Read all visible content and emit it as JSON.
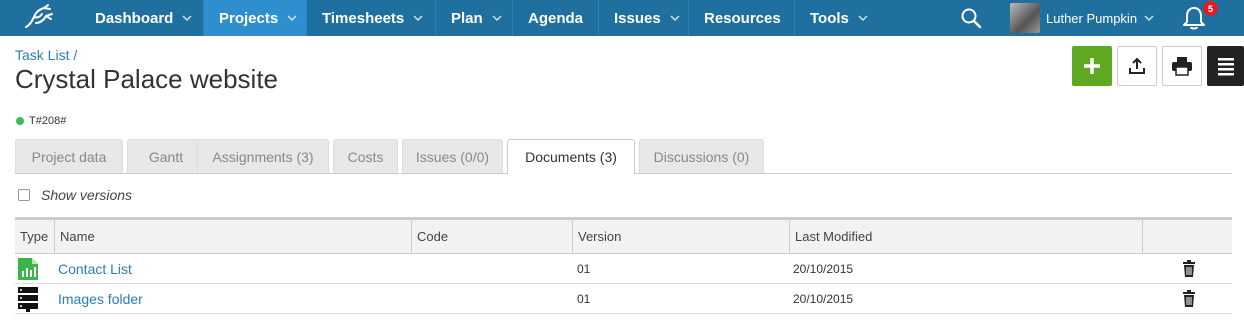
{
  "nav": {
    "items": [
      {
        "label": "Dashboard"
      },
      {
        "label": "Projects"
      },
      {
        "label": "Timesheets"
      },
      {
        "label": "Plan"
      },
      {
        "label": "Agenda"
      },
      {
        "label": "Issues"
      },
      {
        "label": "Resources"
      },
      {
        "label": "Tools"
      }
    ],
    "user_name": "Luther Pumpkin",
    "notification_count": "5"
  },
  "header": {
    "breadcrumb": "Task List /",
    "title": "Crystal Palace website",
    "code": "T#208#"
  },
  "tabs": [
    {
      "label": "Project data"
    },
    {
      "label": "Gantt"
    },
    {
      "label": "Assignments (3)"
    },
    {
      "label": "Costs"
    },
    {
      "label": "Issues (0/0)"
    },
    {
      "label": "Documents (3)"
    },
    {
      "label": "Discussions (0)"
    }
  ],
  "show_versions_label": "Show versions",
  "table": {
    "columns": [
      "Type",
      "Name",
      "Code",
      "Version",
      "Last Modified"
    ],
    "rows": [
      {
        "name": "Contact List",
        "code": "",
        "version": "01",
        "modified": "20/10/2015",
        "icon": "spreadsheet-icon"
      },
      {
        "name": "Images folder",
        "code": "",
        "version": "01",
        "modified": "20/10/2015",
        "icon": "server-icon"
      }
    ]
  },
  "colors": {
    "nav": "#1f6f9f",
    "nav_active": "#2f8fce",
    "link": "#2a7fb4",
    "add": "#5ea822",
    "status": "#3fbb58",
    "badge": "#d91f26"
  }
}
